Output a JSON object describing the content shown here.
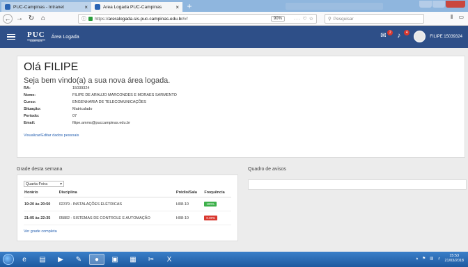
{
  "browser": {
    "tabs": [
      {
        "label": "PUC-Campinas - Intranet",
        "close": "×"
      },
      {
        "label": "Área Logada PUC-Campinas",
        "close": "×"
      }
    ],
    "new_tab": "+",
    "url_prefix": "https://",
    "url_domain": "areralogada.sis.puc-campinas.edu.br",
    "url_suffix": "/#/",
    "zoom": "90%",
    "search_placeholder": "Pesquisar"
  },
  "app": {
    "title": "Área Logada",
    "logo_text": "PUC",
    "logo_sub": "CAMPINAS",
    "notif_count_1": "2",
    "notif_count_2": "4",
    "username": "FILIPE 15039324"
  },
  "welcome": {
    "hello": "Olá FILIPE",
    "greeting": "Seja bem vindo(a) a sua nova área logada.",
    "fields": [
      {
        "label": "RA:",
        "value": "15039324"
      },
      {
        "label": "Nome:",
        "value": "FILIPE DE ARAUJO MARCONDES E MORAES SARMENTO"
      },
      {
        "label": "Curso:",
        "value": "ENGENHARIA DE TELECOMUNICAÇÕES"
      },
      {
        "label": "Situação:",
        "value": "Matriculado"
      },
      {
        "label": "Período:",
        "value": "07"
      },
      {
        "label": "Email:",
        "value": "filipe.amms@puccampinas.edu.br"
      }
    ],
    "edit_link": "Visualizar/Editar dados pessoais"
  },
  "grade": {
    "title": "Grade desta semana",
    "day": "Quarta-Feira",
    "headers": [
      "Horário",
      "Disciplina",
      "Prédio/Sala",
      "Frequência"
    ],
    "rows": [
      {
        "time": "19:20 às 20:50",
        "discipline": "02379 - INSTALAÇÕES ELÉTRICAS",
        "room": "H08-10",
        "freq": "100%",
        "freq_color": "#3cb04a"
      },
      {
        "time": "21:05 às 22:35",
        "discipline": "05882 - SISTEMAS DE CONTROLE E AUTOMAÇÃO",
        "room": "H08-10",
        "freq": "0.00%",
        "freq_color": "#d9382f"
      }
    ],
    "link": "Ver grade completa"
  },
  "avisos": {
    "title": "Quadro de avisos"
  },
  "taskbar": {
    "time": "15:53",
    "date": "21/03/2018"
  },
  "colors": {
    "header_bg": "#2e4f88",
    "link": "#2a64b3"
  }
}
